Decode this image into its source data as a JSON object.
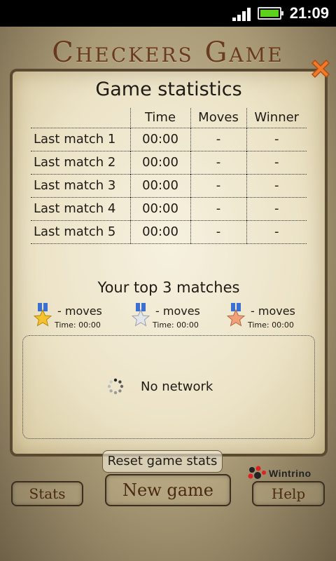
{
  "status_bar": {
    "time": "21:09"
  },
  "app": {
    "title": "Checkers Game"
  },
  "dialog": {
    "title": "Game statistics",
    "columns": [
      "Time",
      "Moves",
      "Winner"
    ],
    "rows": [
      {
        "label": "Last match 1",
        "time": "00:00",
        "moves": "-",
        "winner": "-"
      },
      {
        "label": "Last match 2",
        "time": "00:00",
        "moves": "-",
        "winner": "-"
      },
      {
        "label": "Last match 3",
        "time": "00:00",
        "moves": "-",
        "winner": "-"
      },
      {
        "label": "Last match 4",
        "time": "00:00",
        "moves": "-",
        "winner": "-"
      },
      {
        "label": "Last match 5",
        "time": "00:00",
        "moves": "-",
        "winner": "-"
      }
    ],
    "top3_title": "Your top 3 matches",
    "top3": [
      {
        "medal": "gold-star-medal-icon",
        "moves": "- moves",
        "time": "Time: 00:00"
      },
      {
        "medal": "silver-star-medal-icon",
        "moves": "- moves",
        "time": "Time: 00:00"
      },
      {
        "medal": "bronze-star-medal-icon",
        "moves": "- moves",
        "time": "Time: 00:00"
      }
    ],
    "ad": {
      "status_text": "No network"
    },
    "reset_label": "Reset game stats",
    "brand_name": "Wintrino"
  },
  "bottom": {
    "stats_label": "Stats",
    "new_game_label": "New game",
    "help_label": "Help"
  },
  "colors": {
    "title_brown": "#5e2a0f",
    "battery_green": "#5cd21c",
    "close_orange": "#f07a2a"
  }
}
